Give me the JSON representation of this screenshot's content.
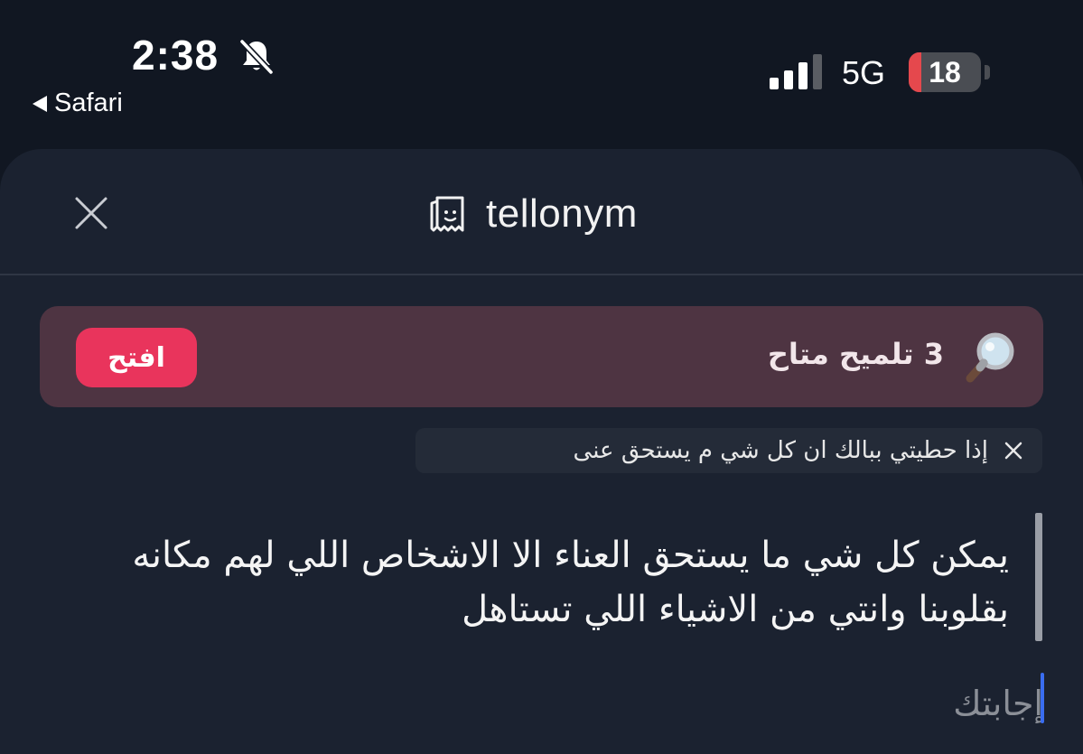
{
  "status_bar": {
    "time": "2:38",
    "back_label": "Safari",
    "network": "5G",
    "battery_level": "18",
    "battery_fraction": 0.18
  },
  "header": {
    "brand": "tellonym",
    "close_icon": "close-icon",
    "logo_icon": "tellonym-logo-icon"
  },
  "hint": {
    "text": "3 تلميح متاح",
    "open_label": "افتح",
    "icon": "magnifier-icon"
  },
  "reply_chip": {
    "text": "إذا حطيتي ببالك ان كل شي م يستحق عنى"
  },
  "question": {
    "text": "يمكن كل شي ما يستحق العناء الا الاشخاص اللي لهم مكانه بقلوبنا وانتي من الاشياء اللي تستاهل"
  },
  "answer": {
    "placeholder": "إجابتك",
    "value": ""
  },
  "colors": {
    "background": "#111722",
    "sheet": "#1b2230",
    "hint_card": "#4e3442",
    "accent": "#e9345c",
    "caret": "#3a6df0",
    "battery_low": "#e5484d"
  }
}
